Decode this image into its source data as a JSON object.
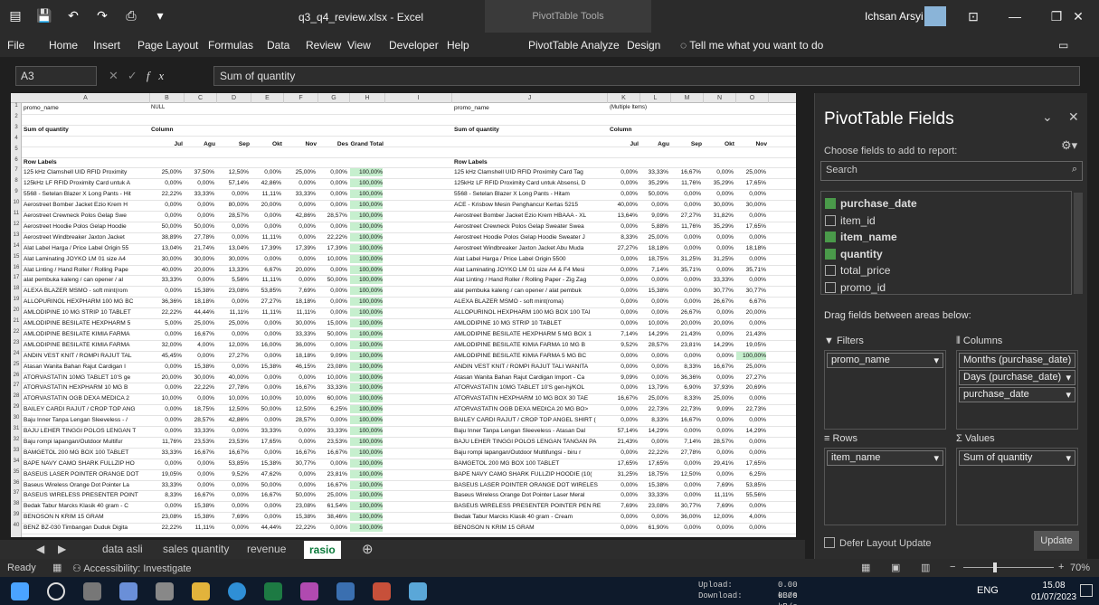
{
  "window": {
    "title": "q3_q4_review.xlsx - Excel",
    "tools_title": "PivotTable Tools",
    "user": "Ichsan Arsyi"
  },
  "ribbon": [
    "File",
    "Home",
    "Insert",
    "Page Layout",
    "Formulas",
    "Data",
    "Review",
    "View",
    "Developer",
    "Help",
    "PivotTable Analyze",
    "Design"
  ],
  "tell_me": "Tell me what you want to do",
  "formula": {
    "namebox": "A3",
    "content": "Sum of quantity"
  },
  "columns": [
    "A",
    "B",
    "C",
    "D",
    "E",
    "F",
    "G",
    "H",
    "I",
    "J",
    "K",
    "L",
    "M",
    "N",
    "O"
  ],
  "pivot_left": {
    "filter_label": "promo_name",
    "filter_value": "NULL",
    "value_label": "Sum of quantity",
    "col_labels": "Column",
    "row_labels": "Row Labels",
    "months": [
      "Jul",
      "Agu",
      "Sep",
      "Okt",
      "Nov",
      "Des",
      "Grand Total"
    ],
    "rows": [
      [
        "125 kHz Clamshell UID RFID Proximity",
        "25,00%",
        "37,50%",
        "12,50%",
        "0,00%",
        "25,00%",
        "0,00%",
        "100,00%"
      ],
      [
        "125kHz LF RFID Proximity Card untuk A",
        "0,00%",
        "0,00%",
        "57,14%",
        "42,86%",
        "0,00%",
        "0,00%",
        "100,00%"
      ],
      [
        "5568 - Setelan Blazer X Long Pants - Hit",
        "22,22%",
        "33,33%",
        "0,00%",
        "11,11%",
        "33,33%",
        "0,00%",
        "100,00%"
      ],
      [
        "Aerostreet Bomber Jacket Ezio Krem H",
        "0,00%",
        "0,00%",
        "80,00%",
        "20,00%",
        "0,00%",
        "0,00%",
        "100,00%"
      ],
      [
        "Aerostreet Crewneck Polos Gelap Swe",
        "0,00%",
        "0,00%",
        "28,57%",
        "0,00%",
        "42,86%",
        "28,57%",
        "100,00%"
      ],
      [
        "Aerostreet Hoodie Polos Gelap Hoodie",
        "50,00%",
        "50,00%",
        "0,00%",
        "0,00%",
        "0,00%",
        "0,00%",
        "100,00%"
      ],
      [
        "Aerostreet Windbreaker Jaxton Jacket",
        "38,89%",
        "27,78%",
        "0,00%",
        "11,11%",
        "0,00%",
        "22,22%",
        "100,00%"
      ],
      [
        "Alat Label Harga / Price Label Origin 55",
        "13,04%",
        "21,74%",
        "13,04%",
        "17,39%",
        "17,39%",
        "17,39%",
        "100,00%"
      ],
      [
        "Alat Laminating JOYKO LM 01 size A4",
        "30,00%",
        "30,00%",
        "30,00%",
        "0,00%",
        "0,00%",
        "10,00%",
        "100,00%"
      ],
      [
        "Alat Linting / Hand Roller / Rolling Pape",
        "40,00%",
        "20,00%",
        "13,33%",
        "6,67%",
        "20,00%",
        "0,00%",
        "100,00%"
      ],
      [
        "alat pembuka kaleng / can opener / al",
        "33,33%",
        "0,00%",
        "5,56%",
        "11,11%",
        "0,00%",
        "50,00%",
        "100,00%"
      ],
      [
        "ALEXA BLAZER MSMO - soft mint(rom",
        "0,00%",
        "15,38%",
        "23,08%",
        "53,85%",
        "7,69%",
        "0,00%",
        "100,00%"
      ],
      [
        "ALLOPURINOL HEXPHARM 100 MG BC",
        "36,36%",
        "18,18%",
        "0,00%",
        "27,27%",
        "18,18%",
        "0,00%",
        "100,00%"
      ],
      [
        "AMLODIPINE 10 MG STRIP 10 TABLET",
        "22,22%",
        "44,44%",
        "11,11%",
        "11,11%",
        "11,11%",
        "0,00%",
        "100,00%"
      ],
      [
        "AMLODIPINE BESILATE HEXPHARM 5",
        "5,00%",
        "25,00%",
        "25,00%",
        "0,00%",
        "30,00%",
        "15,00%",
        "100,00%"
      ],
      [
        "AMLODIPINE BESILATE KIMIA FARMA",
        "0,00%",
        "16,67%",
        "0,00%",
        "0,00%",
        "33,33%",
        "50,00%",
        "100,00%"
      ],
      [
        "AMLODIPINE BESILATE KIMIA FARMA",
        "32,00%",
        "4,00%",
        "12,00%",
        "16,00%",
        "36,00%",
        "0,00%",
        "100,00%"
      ],
      [
        "ANDIN VEST KNIT / ROMPI RAJUT TAL",
        "45,45%",
        "0,00%",
        "27,27%",
        "0,00%",
        "18,18%",
        "9,09%",
        "100,00%"
      ],
      [
        "Atasan Wanita Bahan Rajut Cardigan I",
        "0,00%",
        "15,38%",
        "0,00%",
        "15,38%",
        "46,15%",
        "23,08%",
        "100,00%"
      ],
      [
        "ATORVASTATIN 10MG TABLET 10'S ge",
        "20,00%",
        "30,00%",
        "40,00%",
        "0,00%",
        "0,00%",
        "10,00%",
        "100,00%"
      ],
      [
        "ATORVASTATIN HEXPHARM 10 MG B",
        "0,00%",
        "22,22%",
        "27,78%",
        "0,00%",
        "16,67%",
        "33,33%",
        "100,00%"
      ],
      [
        "ATORVASTATIN OGB DEXA MEDICA 2",
        "10,00%",
        "0,00%",
        "10,00%",
        "10,00%",
        "10,00%",
        "60,00%",
        "100,00%"
      ],
      [
        "BAILEY CARDI RAJUT / CROP TOP ANG",
        "0,00%",
        "18,75%",
        "12,50%",
        "50,00%",
        "12,50%",
        "6,25%",
        "100,00%"
      ],
      [
        "Baju Inner Tanpa Lengan Sleeveless - /",
        "0,00%",
        "28,57%",
        "42,86%",
        "0,00%",
        "28,57%",
        "0,00%",
        "100,00%"
      ],
      [
        "BAJU LEHER TINGGI POLOS LENGAN T",
        "0,00%",
        "33,33%",
        "0,00%",
        "33,33%",
        "0,00%",
        "33,33%",
        "100,00%"
      ],
      [
        "Baju rompi lapangan/Outdoor Multifur",
        "11,76%",
        "23,53%",
        "23,53%",
        "17,65%",
        "0,00%",
        "23,53%",
        "100,00%"
      ],
      [
        "BAMGETOL 200 MG BOX 100 TABLET",
        "33,33%",
        "16,67%",
        "16,67%",
        "0,00%",
        "16,67%",
        "16,67%",
        "100,00%"
      ],
      [
        "BAPE NAVY CAMO SHARK FULLZIP HO",
        "0,00%",
        "0,00%",
        "53,85%",
        "15,38%",
        "30,77%",
        "0,00%",
        "100,00%"
      ],
      [
        "BASEUS LASER POINTER ORANGE DOT",
        "19,05%",
        "0,00%",
        "9,52%",
        "47,62%",
        "0,00%",
        "23,81%",
        "100,00%"
      ],
      [
        "Baseus Wireless Orange Dot Pointer La",
        "33,33%",
        "0,00%",
        "0,00%",
        "50,00%",
        "0,00%",
        "16,67%",
        "100,00%"
      ],
      [
        "BASEUS WIRELESS PRESENTER POINT",
        "8,33%",
        "16,67%",
        "0,00%",
        "16,67%",
        "50,00%",
        "25,00%",
        "100,00%"
      ],
      [
        "Bedak Tabur Marcks Klasik 40 gram - C",
        "0,00%",
        "15,38%",
        "0,00%",
        "0,00%",
        "23,08%",
        "61,54%",
        "100,00%"
      ],
      [
        "BENOSON N KRIM 15 GRAM",
        "23,08%",
        "15,38%",
        "7,69%",
        "0,00%",
        "15,38%",
        "38,46%",
        "100,00%"
      ],
      [
        "BENZ BZ-030 Timbangan Duduk Digita",
        "22,22%",
        "11,11%",
        "0,00%",
        "44,44%",
        "22,22%",
        "0,00%",
        "100,00%"
      ]
    ]
  },
  "pivot_right": {
    "filter_label": "promo_name",
    "filter_value": "(Multiple Items)",
    "value_label": "Sum of quantity",
    "col_labels": "Column",
    "row_labels": "Row Labels",
    "months": [
      "Jul",
      "Agu",
      "Sep",
      "Okt",
      "Nov"
    ],
    "rows": [
      [
        "125 kHz Clamshell UID RFID Proximity Card Tag",
        "0,00%",
        "33,33%",
        "16,67%",
        "0,00%",
        "25,00%"
      ],
      [
        "125kHz LF RFID Proximity Card untuk Absensi, D",
        "0,00%",
        "35,29%",
        "11,76%",
        "35,29%",
        "17,65%"
      ],
      [
        "5568 - Setelan Blazer X Long Pants - Hitam",
        "0,00%",
        "50,00%",
        "0,00%",
        "0,00%",
        "0,00%"
      ],
      [
        "ACE - Krisbow Mesin Penghancur Kertas 5215",
        "40,00%",
        "0,00%",
        "0,00%",
        "30,00%",
        "30,00%"
      ],
      [
        "Aerostreet Bomber Jacket Ezio Krem HBAAA - XL",
        "13,64%",
        "9,09%",
        "27,27%",
        "31,82%",
        "0,00%"
      ],
      [
        "Aerostreet Crewneck Polos Gelap Sweater Swea",
        "0,00%",
        "5,88%",
        "11,76%",
        "35,29%",
        "17,65%"
      ],
      [
        "Aerostreet Hoodie Polos Gelap Hoodie Sweater J",
        "8,33%",
        "25,00%",
        "0,00%",
        "0,00%",
        "0,00%"
      ],
      [
        "Aerostreet Windbreaker Jaxton Jacket Abu Muda",
        "27,27%",
        "18,18%",
        "0,00%",
        "0,00%",
        "18,18%"
      ],
      [
        "Alat Label Harga / Price Label Origin 5500",
        "0,00%",
        "18,75%",
        "31,25%",
        "31,25%",
        "0,00%"
      ],
      [
        "Alat Laminating JOYKO LM 01 size A4 & F4 Mesi",
        "0,00%",
        "7,14%",
        "35,71%",
        "0,00%",
        "35,71%"
      ],
      [
        "Alat Linting / Hand Roller / Rolling Paper - Zig Zag",
        "0,00%",
        "0,00%",
        "0,00%",
        "33,33%",
        "0,00%"
      ],
      [
        "alat pembuka kaleng / can opener / alat pembuk",
        "0,00%",
        "15,38%",
        "0,00%",
        "30,77%",
        "30,77%"
      ],
      [
        "ALEXA BLAZER MSMO - soft mint(roma)",
        "0,00%",
        "0,00%",
        "0,00%",
        "26,67%",
        "6,67%"
      ],
      [
        "ALLOPURINOL HEXPHARM 100 MG BOX 100 TAI",
        "0,00%",
        "0,00%",
        "26,67%",
        "0,00%",
        "20,00%"
      ],
      [
        "AMLODIPINE 10 MG STRIP 10 TABLET",
        "0,00%",
        "10,00%",
        "20,00%",
        "20,00%",
        "0,00%"
      ],
      [
        "AMLODIPINE BESILATE HEXPHARM 5 MG BOX 1",
        "7,14%",
        "14,29%",
        "21,43%",
        "0,00%",
        "21,43%"
      ],
      [
        "AMLODIPINE BESILATE KIMIA FARMA 10 MG B",
        "9,52%",
        "28,57%",
        "23,81%",
        "14,29%",
        "19,05%"
      ],
      [
        "AMLODIPINE BESILATE KIMIA FARMA 5 MG BC",
        "0,00%",
        "0,00%",
        "0,00%",
        "0,00%",
        "100,00%"
      ],
      [
        "ANDIN VEST KNIT / ROMPI RAJUT TALI WANITA",
        "0,00%",
        "0,00%",
        "8,33%",
        "16,67%",
        "25,00%"
      ],
      [
        "Atasan Wanita Bahan Rajut Cardigan Import - Ca",
        "9,09%",
        "0,00%",
        "36,36%",
        "0,00%",
        "27,27%"
      ],
      [
        "ATORVASTATIN 10MG TABLET 10'S gen-hj/KOL",
        "0,00%",
        "13,79%",
        "6,90%",
        "37,93%",
        "20,69%"
      ],
      [
        "ATORVASTATIN HEXPHARM 10 MG BOX 30 TAE",
        "16,67%",
        "25,00%",
        "8,33%",
        "25,00%",
        "0,00%"
      ],
      [
        "ATORVASTATIN OGB DEXA MEDICA 20 MG BO>",
        "0,00%",
        "22,73%",
        "22,73%",
        "9,09%",
        "22,73%"
      ],
      [
        "BAILEY CARDI RAJUT / CROP TOP ANGEL SHIRT (",
        "0,00%",
        "8,33%",
        "16,67%",
        "0,00%",
        "0,00%"
      ],
      [
        "Baju Inner Tanpa Lengan Sleeveless - Atasan Dal",
        "57,14%",
        "14,29%",
        "0,00%",
        "0,00%",
        "14,29%"
      ],
      [
        "BAJU LEHER TINGGI POLOS LENGAN TANGAN PA",
        "21,43%",
        "0,00%",
        "7,14%",
        "28,57%",
        "0,00%"
      ],
      [
        "Baju rompi lapangan/Outdoor Multifungsi - biru r",
        "0,00%",
        "22,22%",
        "27,78%",
        "0,00%",
        "0,00%"
      ],
      [
        "BAMGETOL 200 MG BOX 100 TABLET",
        "17,65%",
        "17,65%",
        "0,00%",
        "29,41%",
        "17,65%"
      ],
      [
        "BAPE NAVY CAMO SHARK FULLZIP HOODIE (10(",
        "31,25%",
        "18,75%",
        "12,50%",
        "0,00%",
        "6,25%"
      ],
      [
        "BASEUS LASER POINTER ORANGE DOT WIRELES",
        "0,00%",
        "15,38%",
        "0,00%",
        "7,69%",
        "53,85%"
      ],
      [
        "Baseus Wireless Orange Dot Pointer Laser Meral",
        "0,00%",
        "33,33%",
        "0,00%",
        "11,11%",
        "55,56%"
      ],
      [
        "BASEUS WIRELESS PRESENTER POINTER PEN RE",
        "7,69%",
        "23,08%",
        "30,77%",
        "7,69%",
        "0,00%"
      ],
      [
        "Bedak Tabur Marcks Klasik 40 gram - Cream",
        "0,00%",
        "0,00%",
        "36,00%",
        "12,00%",
        "4,00%"
      ],
      [
        "BENOSON N KRIM 15 GRAM",
        "0,00%",
        "61,90%",
        "0,00%",
        "0,00%",
        "0,00%"
      ]
    ]
  },
  "pane": {
    "title": "PivotTable Fields",
    "hint": "Choose fields to add to report:",
    "search": "Search",
    "fields": [
      {
        "name": "purchase_date",
        "checked": true
      },
      {
        "name": "item_id",
        "checked": false
      },
      {
        "name": "item_name",
        "checked": true
      },
      {
        "name": "quantity",
        "checked": true
      },
      {
        "name": "total_price",
        "checked": false
      },
      {
        "name": "promo_id",
        "checked": false
      }
    ],
    "drag": "Drag fields between areas below:",
    "filters_label": "Filters",
    "columns_label": "Columns",
    "rows_label": "Rows",
    "values_label": "Values",
    "filters": [
      "promo_name"
    ],
    "columns": [
      "Months (purchase_date)",
      "Days (purchase_date)",
      "purchase_date"
    ],
    "rows": [
      "item_name"
    ],
    "values": [
      "Sum of quantity"
    ],
    "defer": "Defer Layout Update",
    "update": "Update"
  },
  "sheets": [
    "data asli",
    "sales quantity",
    "revenue",
    "rasio"
  ],
  "active_sheet": "rasio",
  "status": {
    "ready": "Ready",
    "accessibility": "Accessibility: Investigate",
    "zoom": "70%"
  },
  "taskbar": {
    "upload": "Upload:",
    "download": "Download:",
    "up_val": "0.00 kB/s",
    "down_val": "0.00 kB/s",
    "lang": "ENG",
    "time": "15.08",
    "date": "01/07/2023"
  }
}
